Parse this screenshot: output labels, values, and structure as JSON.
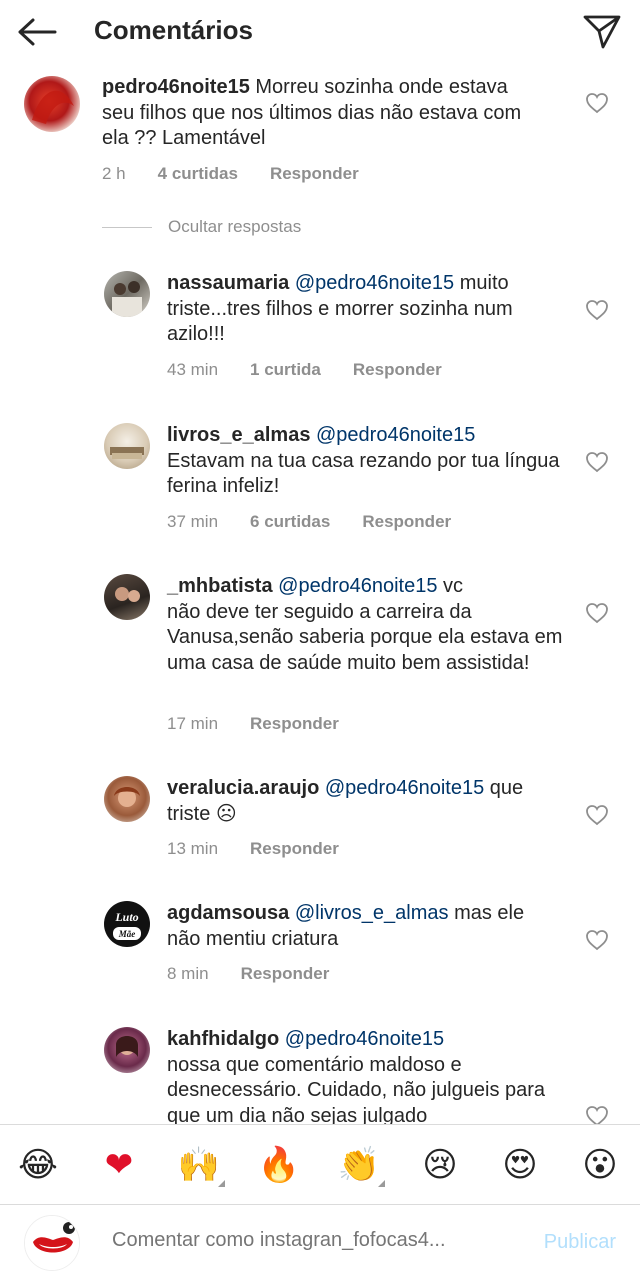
{
  "header": {
    "title": "Comentários"
  },
  "main_comment": {
    "username": "pedro46noite15",
    "text": " Morreu sozinha onde estava seu filhos que nos últimos dias não estava com ela ?? Lamentável",
    "time": "2 h",
    "likes": "4 curtidas",
    "reply": "Responder"
  },
  "hide_replies_label": "Ocultar respostas",
  "replies": [
    {
      "username": "nassaumaria",
      "mention": " @pedro46noite15",
      "text_line1": " muito",
      "text_rest": "triste...tres filhos e morrer sozinha num azilo!!!",
      "time": "43 min",
      "likes": "1 curtida",
      "reply": "Responder"
    },
    {
      "username": "livros_e_almas",
      "mention": " @pedro46noite15",
      "text_line1": "",
      "text_rest": "Estavam na tua casa  rezando por tua língua ferina infeliz!",
      "time": "37 min",
      "likes": "6 curtidas",
      "reply": "Responder"
    },
    {
      "username": "_mhbatista",
      "mention": " @pedro46noite15",
      "text_line1": " vc",
      "text_rest": "não deve ter seguido a carreira da Vanusa,senão saberia porque ela estava em uma casa de saúde muito bem assistida!",
      "time": "17 min",
      "likes": "",
      "reply": "Responder"
    },
    {
      "username": "veralucia.araujo",
      "mention": " @pedro46noite15",
      "text_line1": " que",
      "text_rest": "triste ☹",
      "time": "13 min",
      "likes": "",
      "reply": "Responder"
    },
    {
      "username": "agdamsousa",
      "mention": " @livros_e_almas",
      "text_line1": " mas ele",
      "text_rest": "não mentiu criatura",
      "time": "8 min",
      "likes": "",
      "reply": "Responder",
      "avatar_text_top": "Luto",
      "avatar_text_bottom": "Mãe"
    },
    {
      "username": "kahfhidalgo",
      "mention": " @pedro46noite15",
      "text_line1": "",
      "text_rest": "nossa que comentário maldoso e desnecessário.  Cuidado, não julgueis para que um dia não sejas julgado",
      "time": "",
      "likes": "",
      "reply": ""
    }
  ],
  "emojis": [
    "😂",
    "❤",
    "🙌",
    "🔥",
    "👏",
    "😢",
    "😍",
    "😮"
  ],
  "compose": {
    "placeholder": "Comentar como instagran_fofocas4...",
    "publish_label": "Publicar"
  },
  "colors": {
    "mention": "#003569",
    "muted": "#8e8e8e",
    "publish": "#b2dffc",
    "heart_red": "#e0102a"
  }
}
